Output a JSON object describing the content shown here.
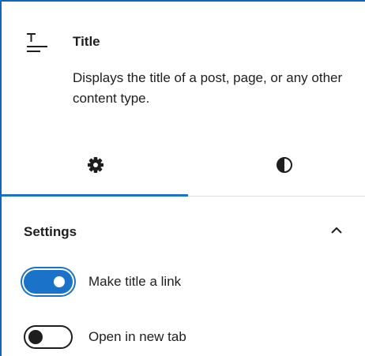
{
  "block": {
    "icon": "title-icon",
    "title": "Title",
    "description": "Displays the title of a post, page, or any other content type."
  },
  "tabs": [
    {
      "name": "settings",
      "icon": "gear-icon",
      "active": true
    },
    {
      "name": "styles",
      "icon": "half-circle-contrast-icon",
      "active": false
    }
  ],
  "settings_panel": {
    "title": "Settings",
    "expanded": true,
    "chevron_icon": "chevron-up-icon",
    "toggles": [
      {
        "label": "Make title a link",
        "checked": true
      },
      {
        "label": "Open in new tab",
        "checked": false
      }
    ]
  },
  "colors": {
    "accent": "#1a73c8",
    "text": "#1e1e1e",
    "divider": "#dddddd"
  }
}
